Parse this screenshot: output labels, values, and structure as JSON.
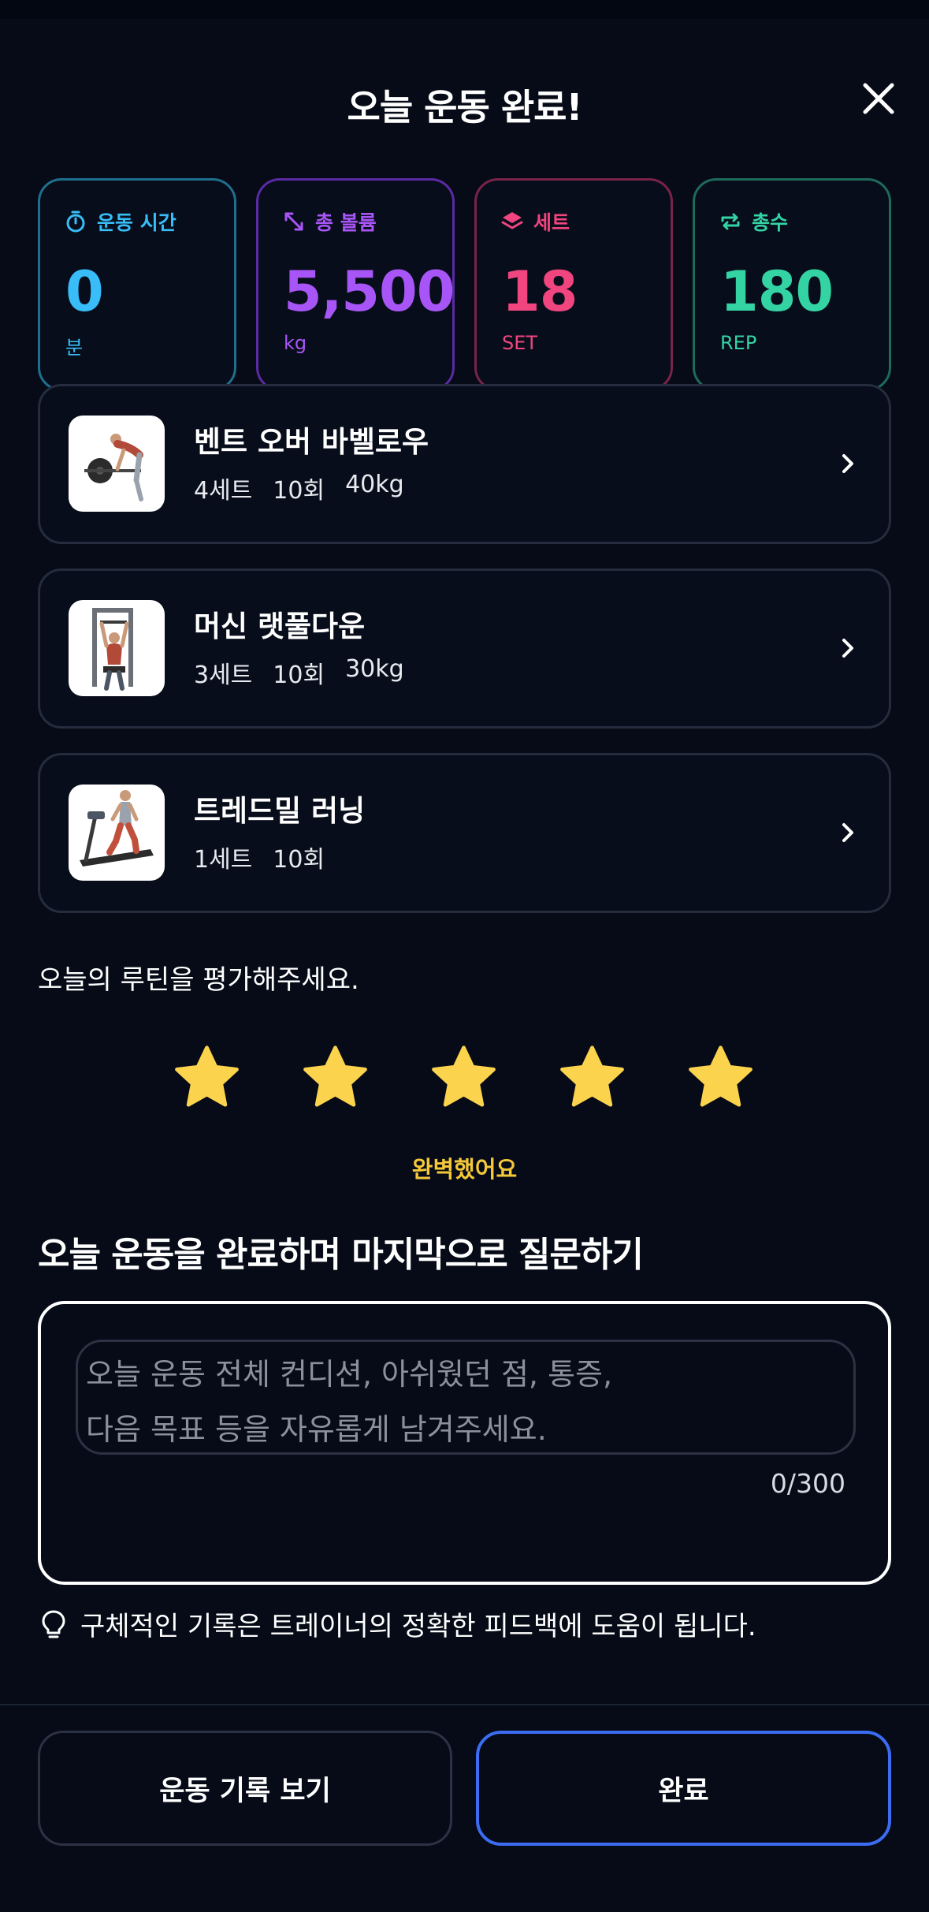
{
  "header": {
    "title": "오늘 운동 완료!"
  },
  "stats": [
    {
      "label": "운동 시간",
      "value": "0",
      "unit": "분",
      "icon": "stopwatch-icon",
      "color": "#38bdf8"
    },
    {
      "label": "총 볼륨",
      "value": "5,500",
      "unit": "kg",
      "icon": "expand-arrows-icon",
      "color": "#a855f7"
    },
    {
      "label": "세트",
      "value": "18",
      "unit": "SET",
      "icon": "layers-icon",
      "color": "#f0457e"
    },
    {
      "label": "총수",
      "value": "180",
      "unit": "REP",
      "icon": "repeat-icon",
      "color": "#34d3a4"
    }
  ],
  "exercises": [
    {
      "name": "벤트 오버 바벨로우",
      "sets": "4세트",
      "reps": "10회",
      "weight": "40kg",
      "image": "barbell-row-figure"
    },
    {
      "name": "머신 랫풀다운",
      "sets": "3세트",
      "reps": "10회",
      "weight": "30kg",
      "image": "lat-pulldown-machine-figure"
    },
    {
      "name": "트레드밀 러닝",
      "sets": "1세트",
      "reps": "10회",
      "weight": "",
      "image": "treadmill-runner-figure"
    }
  ],
  "rating": {
    "label": "오늘의 루틴을 평가해주세요.",
    "value": 5,
    "max": 5,
    "caption": "완벽했어요",
    "star_color": "#fcd34d"
  },
  "question": {
    "title": "오늘 운동을 완료하며 마지막으로 질문하기",
    "placeholder": "오늘 운동 전체 컨디션, 아쉬웠던 점, 통증,\n다음 목표 등을 자유롭게 남겨주세요.",
    "value": "",
    "counter": "0/300"
  },
  "tip": {
    "text": "구체적인 기록은 트레이너의 정확한 피드백에 도움이 됩니다.",
    "icon": "lightbulb-icon"
  },
  "buttons": {
    "history": "운동 기록 보기",
    "done": "완료",
    "accent": "#3b6cf2"
  }
}
